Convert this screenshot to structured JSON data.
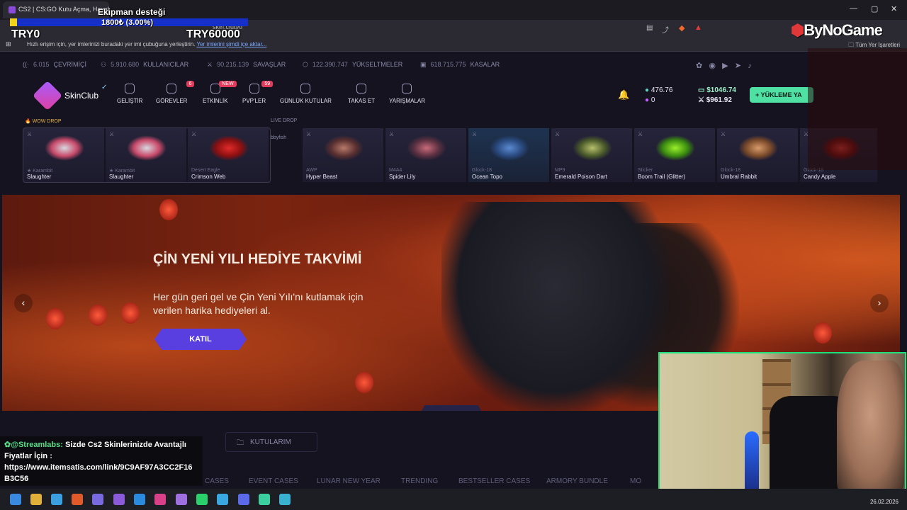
{
  "browser": {
    "tab_title": "CS2 | CS:GO Kutu Açma, Havalı",
    "url": "skin.club/tr",
    "bookmarks_hint": "Hızlı erişim için, yer imlerinizi buradaki yer imi çubuğuna yerleştirin.",
    "bookmarks_link": "Yer imlerini şimdi içe aktar...",
    "all_bookmarks": "Tüm Yer İşaretleri",
    "window_controls": [
      "—",
      "▢",
      "✕"
    ]
  },
  "overlay": {
    "donation_title": "Ekipman desteği",
    "progress_text": "1800₺ (3.00%)",
    "progress_fraction": 0.03,
    "min_label": "TRY0",
    "max_label": "TRY60000",
    "logo_text": "ByNoGame"
  },
  "stats": [
    {
      "value": "6.015",
      "label": "ÇEVRİMİÇİ",
      "icon": "signal-icon"
    },
    {
      "value": "5.910.680",
      "label": "KULLANICILAR",
      "icon": "user-icon"
    },
    {
      "value": "90.215.139",
      "label": "SAVAŞLAR",
      "icon": "sword-icon"
    },
    {
      "value": "122.390.747",
      "label": "YÜKSELTMELER",
      "icon": "upgrade-icon"
    },
    {
      "value": "618.715.775",
      "label": "KASALAR",
      "icon": "case-icon"
    }
  ],
  "header": {
    "logo": "SkinClub",
    "nav": [
      {
        "label": "GELİŞTİR",
        "badge": ""
      },
      {
        "label": "GÖREVLER",
        "badge": "6"
      },
      {
        "label": "ETKİNLİK",
        "badge": "NEW"
      },
      {
        "label": "PVP'LER",
        "badge": "59"
      },
      {
        "label": "GÜNLÜK KUTULAR",
        "badge": ""
      },
      {
        "label": "TAKAS ET",
        "badge": ""
      },
      {
        "label": "YARIŞMALAR",
        "badge": ""
      }
    ],
    "coins": "476.76",
    "gems": "0",
    "balance_main": "$1046.74",
    "balance_sub": "$961.92",
    "deposit_label": "YÜKLEME YA"
  },
  "drops": {
    "wow_label": "WOW DROP",
    "live_label": "LIVE DROP",
    "live_user": "bbyfish",
    "wow": [
      {
        "type": "★ Karambit",
        "name": "Slaughter",
        "color": "#c84a6a"
      },
      {
        "type": "★ Karambit",
        "name": "Slaughter",
        "color": "#c84a6a"
      },
      {
        "type": "Desert Eagle",
        "name": "Crimson Web",
        "color": "#b81f22"
      }
    ],
    "live": [
      {
        "type": "AWP",
        "name": "Hyper Beast",
        "color": "#9a5a4a"
      },
      {
        "type": "M4A4",
        "name": "Spider Lily",
        "color": "#8a4a5a"
      },
      {
        "type": "Glock-18",
        "name": "Ocean Topo",
        "color": "#3a6aa8"
      },
      {
        "type": "MP9",
        "name": "Emerald Poison Dart",
        "color": "#6a7a3a"
      },
      {
        "type": "Sticker",
        "name": "Boom Trail (Glitter)",
        "color": "#7ae02a"
      },
      {
        "type": "Glock-18",
        "name": "Umbral Rabbit",
        "color": "#a86a4a"
      },
      {
        "type": "Glock-18",
        "name": "Candy Apple",
        "color": "#a82a2a"
      }
    ]
  },
  "hero": {
    "title": "ÇİN YENİ YILI HEDİYE TAKVİMİ",
    "subtitle": "Her gün geri gel ve Çin Yeni Yılı'nı kutlamak için verilen harika hediyeleri al.",
    "cta": "KATIL",
    "prev": "‹",
    "next": "›"
  },
  "below": {
    "my_cases": "KUTULARIM",
    "categories": [
      "CASES",
      "EVENT CASES",
      "LUNAR NEW YEAR",
      "TRENDING",
      "BESTSELLER CASES",
      "ARMORY BUNDLE",
      "MO"
    ]
  },
  "streamlabs": {
    "user": "@Streamlabs:",
    "text1": " Sizde Cs2 Skinlerinizde Avantajlı",
    "text2": "Fiyatlar İçin :",
    "text3": "https://www.itemsatis.com/link/9C9AF97A3CC2F16",
    "text4": "B3C56"
  },
  "taskbar": {
    "date": "26.02.2026",
    "apps": [
      "start-icon",
      "explorer-icon",
      "photos-icon",
      "brave-icon",
      "app-icon",
      "visual-studio-icon",
      "vscode-icon",
      "instagram-icon",
      "pen-icon",
      "spotify-icon",
      "telegram-icon",
      "discord-icon",
      "game-icon",
      "notepad-icon"
    ]
  }
}
